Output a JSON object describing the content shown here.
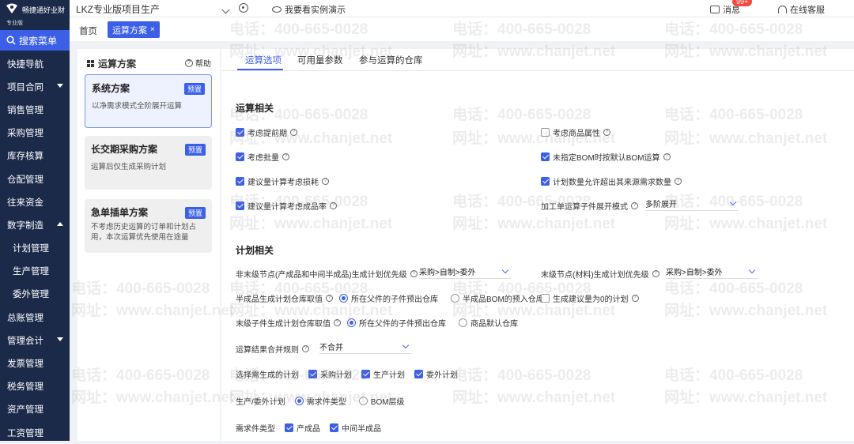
{
  "sidebar": {
    "logo_text": "畅捷通好业财",
    "logo_sub": "专业版",
    "search_label": "搜索菜单",
    "items": [
      {
        "label": "快捷导航",
        "caret": ""
      },
      {
        "label": "项目合同",
        "caret": "down"
      },
      {
        "label": "销售管理",
        "caret": ""
      },
      {
        "label": "采购管理",
        "caret": ""
      },
      {
        "label": "库存核算",
        "caret": ""
      },
      {
        "label": "仓配管理",
        "caret": ""
      },
      {
        "label": "往来资金",
        "caret": ""
      },
      {
        "label": "数字制造",
        "caret": "up"
      },
      {
        "label": "计划管理",
        "caret": "",
        "sub": true
      },
      {
        "label": "生产管理",
        "caret": "",
        "sub": true
      },
      {
        "label": "委外管理",
        "caret": "",
        "sub": true
      },
      {
        "label": "总账管理",
        "caret": ""
      },
      {
        "label": "管理会计",
        "caret": "down"
      },
      {
        "label": "发票管理",
        "caret": ""
      },
      {
        "label": "税务管理",
        "caret": ""
      },
      {
        "label": "资产管理",
        "caret": ""
      },
      {
        "label": "工资管理",
        "caret": ""
      }
    ]
  },
  "topbar": {
    "project": "LKZ专业版项目生产",
    "demo": "我要看实例演示",
    "messages": "消息",
    "badge": "99+",
    "service": "在线客服"
  },
  "tabs": {
    "home": "首页",
    "active": "运算方案",
    "close": "×"
  },
  "left_panel": {
    "title": "运算方案",
    "help": "帮助",
    "cards": [
      {
        "title": "系统方案",
        "badge": "预置",
        "desc": "以净需求模式全阶展开运算",
        "selected": true
      },
      {
        "title": "长交期采购方案",
        "badge": "预置",
        "desc": "运算后仅生成采购计划",
        "selected": false
      },
      {
        "title": "急单插单方案",
        "badge": "预置",
        "desc": "不考虑历史运算的订单和计划占用，本次运算优先使用在途量",
        "selected": false
      }
    ]
  },
  "main_tabs": [
    "运算选项",
    "可用量参数",
    "参与运算的仓库"
  ],
  "calc": {
    "title": "运算相关",
    "opt1": "考虑提前期",
    "opt2": "考虑商品属性",
    "opt3": "考虑批量",
    "opt4": "未指定BOM时按默认BOM运算",
    "opt5": "建议量计算考虑损耗",
    "opt6": "计划数量允许超出其来源需求数量",
    "opt7": "建议量计算考虑成品率",
    "expand_label": "加工单运算子件展开模式",
    "expand_value": "多阶展开"
  },
  "plan": {
    "title": "计划相关",
    "nonleaf_label": "非末级节点(产成品和中间半成品)生成计划优先级",
    "nonleaf_value": "采购>自制>委外",
    "leaf_label": "末级节点(材料)生成计划优先级",
    "leaf_value": "采购>自制>委外",
    "semi_label": "半成品生成计划仓库取值",
    "semi_opt1": "所在父件的子件预出仓库",
    "semi_opt2": "半成品BOM的预入仓库",
    "zero_plan": "生成建议量为0的计划",
    "leafwh_label": "末级子件生成计划仓库取值",
    "leafwh_opt1": "所在父件的子件预出仓库",
    "leafwh_opt2": "商品默认仓库",
    "merge_label": "运算结果合并规则",
    "merge_value": "不合并",
    "gen_label": "选择需生成的计划",
    "gen1": "采购计划",
    "gen2": "生产计划",
    "gen3": "委外计划",
    "prod_label": "生产/委外计划",
    "prod_opt1": "需求件类型",
    "prod_opt2": "BOM层级",
    "type_label": "需求件类型",
    "type1": "产成品",
    "type2": "中间半成品"
  },
  "watermark": {
    "phone": "电话：400-665-0028",
    "site": "网址：www.chanjet.net"
  },
  "colors": {
    "sidebar": "#1c2a4a",
    "accent": "#3c5fe8",
    "badge": "#f5483b"
  }
}
